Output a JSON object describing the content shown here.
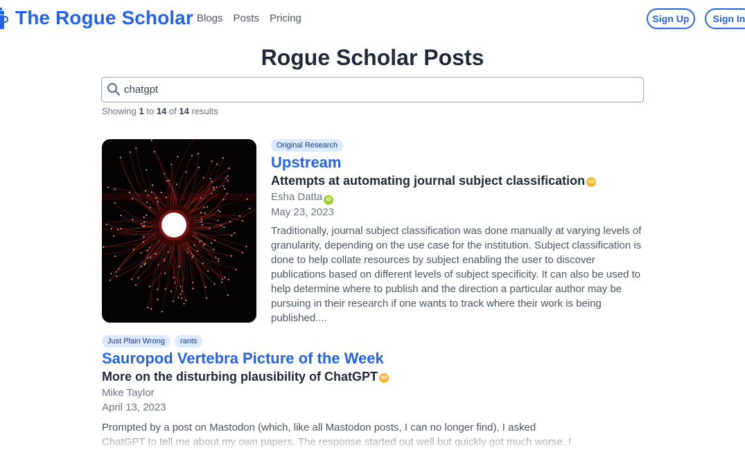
{
  "navbar": {
    "brand": "The Rogue Scholar",
    "links": [
      "Blogs",
      "Posts",
      "Pricing"
    ],
    "sign_up": "Sign Up",
    "sign_in": "Sign In",
    "brand_color": "#2563eb"
  },
  "page": {
    "title": "Rogue Scholar Posts"
  },
  "search": {
    "value": "chatgpt",
    "icon": "search-icon"
  },
  "results": {
    "prefix": "Showing",
    "from": "1",
    "to_word": "to",
    "to": "14",
    "of_word": "of",
    "total": "14",
    "suffix": "results"
  },
  "posts": [
    {
      "tags": [
        "Original Research"
      ],
      "blog": "Upstream",
      "title": "Attempts at automating journal subject classification",
      "doi_badge": "doi",
      "author": "Esha Datta",
      "orcid_badge": "iD",
      "date": "May 23, 2023",
      "summary": "Traditionally, journal subject classification was done manually at varying levels of granularity, depending on the use case for the institution. Subject classification is done to help collate resources by subject enabling the user to discover publications based on different levels of subject specificity. It can also be used to help determine where to publish and the direction a particular author may be pursuing in their research if one wants to track where their work is being published....",
      "image": "red-fiber-optic-burst"
    },
    {
      "tags": [
        "Just Plain Wrong",
        "rants"
      ],
      "blog": "Sauropod Vertebra Picture of the Week",
      "title": "More on the disturbing plausibility of ChatGPT",
      "doi_badge": "doi",
      "author": "Mike Taylor",
      "date": "April 13, 2023",
      "summary": "Prompted by a post on Mastodon (which, like all Mastodon posts, I can no longer find), I asked ChatGPT to tell me about my own papers. The response started out well but quickly got much worse. I"
    }
  ]
}
